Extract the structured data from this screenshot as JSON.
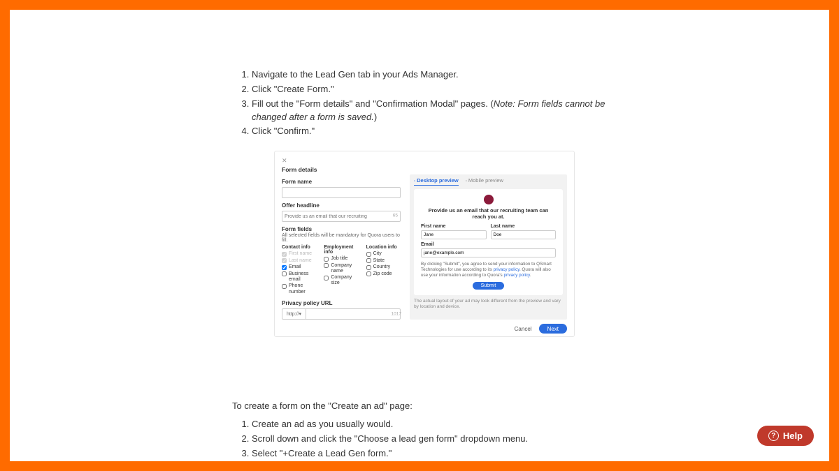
{
  "instructions_top": [
    "Navigate to the Lead Gen tab in your Ads Manager.",
    "Click \"Create Form.\"",
    {
      "main": "Fill out the \"Form details\" and \"Confirmation Modal\" pages. (",
      "note": "Note: Form fields cannot be changed after a form is saved.",
      "tail": ")"
    },
    "Click \"Confirm.\""
  ],
  "card": {
    "close": "✕",
    "title": "Form details",
    "form_name_label": "Form name",
    "offer_headline_label": "Offer headline",
    "offer_headline_placeholder": "Provide us an email that our recruiting",
    "offer_headline_count": "65",
    "form_fields_label": "Form fields",
    "form_fields_hint": "All selected fields will be mandatory for Quora users to fill.",
    "cols": {
      "contact": {
        "head": "Contact info",
        "items": [
          {
            "label": "First name",
            "locked": true,
            "checked": true
          },
          {
            "label": "Last name",
            "locked": true,
            "checked": true
          },
          {
            "label": "Email",
            "locked": false,
            "checked": true
          },
          {
            "label": "Business email",
            "locked": false,
            "checked": false
          },
          {
            "label": "Phone number",
            "locked": false,
            "checked": false
          }
        ]
      },
      "employment": {
        "head": "Employment info",
        "items": [
          {
            "label": "Job title",
            "checked": false
          },
          {
            "label": "Company name",
            "checked": false
          },
          {
            "label": "Company size",
            "checked": false
          }
        ]
      },
      "location": {
        "head": "Location info",
        "items": [
          {
            "label": "City",
            "checked": false
          },
          {
            "label": "State",
            "checked": false
          },
          {
            "label": "Country",
            "checked": false
          },
          {
            "label": "Zip code",
            "checked": false
          }
        ]
      }
    },
    "privacy_label": "Privacy policy URL",
    "privacy_prefix": "http://▾",
    "privacy_count": "1017",
    "preview": {
      "tabs": {
        "desktop": "Desktop preview",
        "mobile": "Mobile preview"
      },
      "headline": "Provide us an email that our recruiting team can reach you at.",
      "first_name_label": "First name",
      "first_name_value": "Jane",
      "last_name_label": "Last name",
      "last_name_value": "Doe",
      "email_label": "Email",
      "email_value": "jane@example.com",
      "legal_pre": "By clicking \"Submit\", you agree to send your information to QSmart Technologies for use according to its ",
      "legal_link1": "privacy policy",
      "legal_mid": ". Quora will also use your information according to Quora's ",
      "legal_link2": "privacy policy",
      "legal_tail": ".",
      "submit": "Submit",
      "note": "The actual layout of your ad may look different from the preview and vary by location and device."
    },
    "footer": {
      "cancel": "Cancel",
      "next": "Next"
    }
  },
  "lower": {
    "intro": "To create a form on the \"Create an ad\" page:",
    "steps": [
      "Create an ad as you usually would.",
      "Scroll down and click the \"Choose a lead gen form\" dropdown menu.",
      "Select \"+Create a Lead Gen form.\""
    ]
  },
  "help": {
    "label": "Help",
    "q": "?"
  }
}
